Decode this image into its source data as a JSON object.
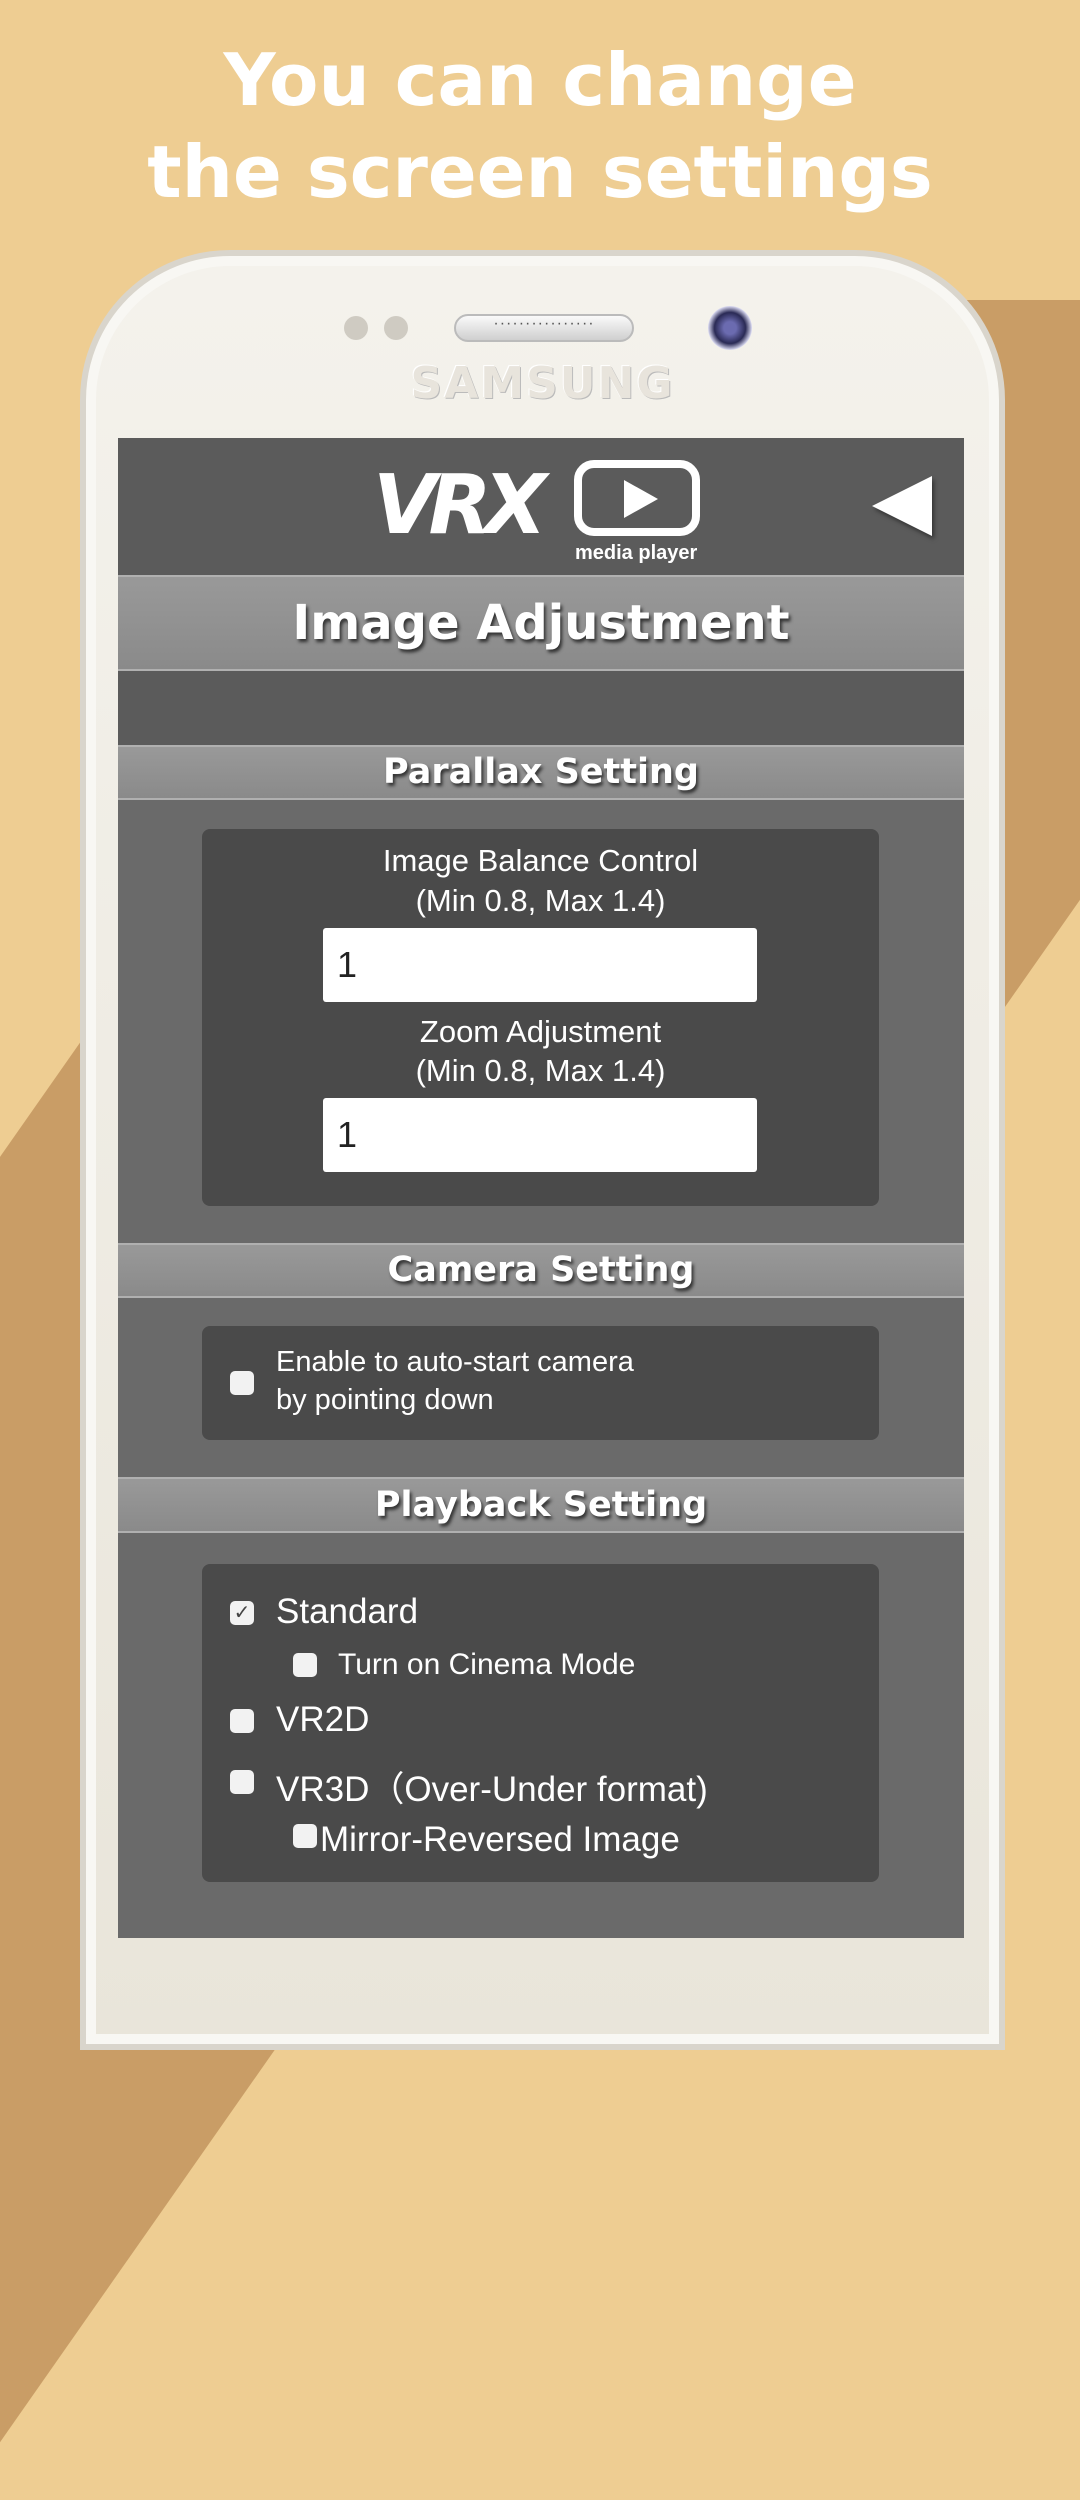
{
  "headline": {
    "line1": "You can change",
    "line2": "the screen settings"
  },
  "device": {
    "brand": "SAMSUNG",
    "speaker": "················"
  },
  "header": {
    "logo_text": "VRX",
    "logo_subtitle": "media player",
    "back_icon": "back-arrow-icon"
  },
  "page_title": "Image Adjustment",
  "parallax": {
    "title": "Parallax Setting",
    "balance_label": "Image Balance Control",
    "balance_range": "(Min 0.8, Max 1.4)",
    "balance_value": "1",
    "zoom_label": "Zoom Adjustment",
    "zoom_range": "(Min 0.8, Max 1.4)",
    "zoom_value": "1"
  },
  "camera": {
    "title": "Camera Setting",
    "auto_start_line1": "Enable to auto-start camera",
    "auto_start_line2": "by pointing down",
    "auto_start_checked": false
  },
  "playback": {
    "title": "Playback Setting",
    "options": [
      {
        "label": "Standard",
        "checked": true
      },
      {
        "label": "Turn on Cinema Mode",
        "checked": false
      },
      {
        "label": "VR2D",
        "checked": false
      },
      {
        "label": "VR3D（Over-Under format)",
        "checked": false
      },
      {
        "label": "Mirror-Reversed Image",
        "checked": false
      }
    ]
  },
  "colors": {
    "background": "#eecd92",
    "screen": "#6a6a6a",
    "panel": "#4a4a4a"
  }
}
